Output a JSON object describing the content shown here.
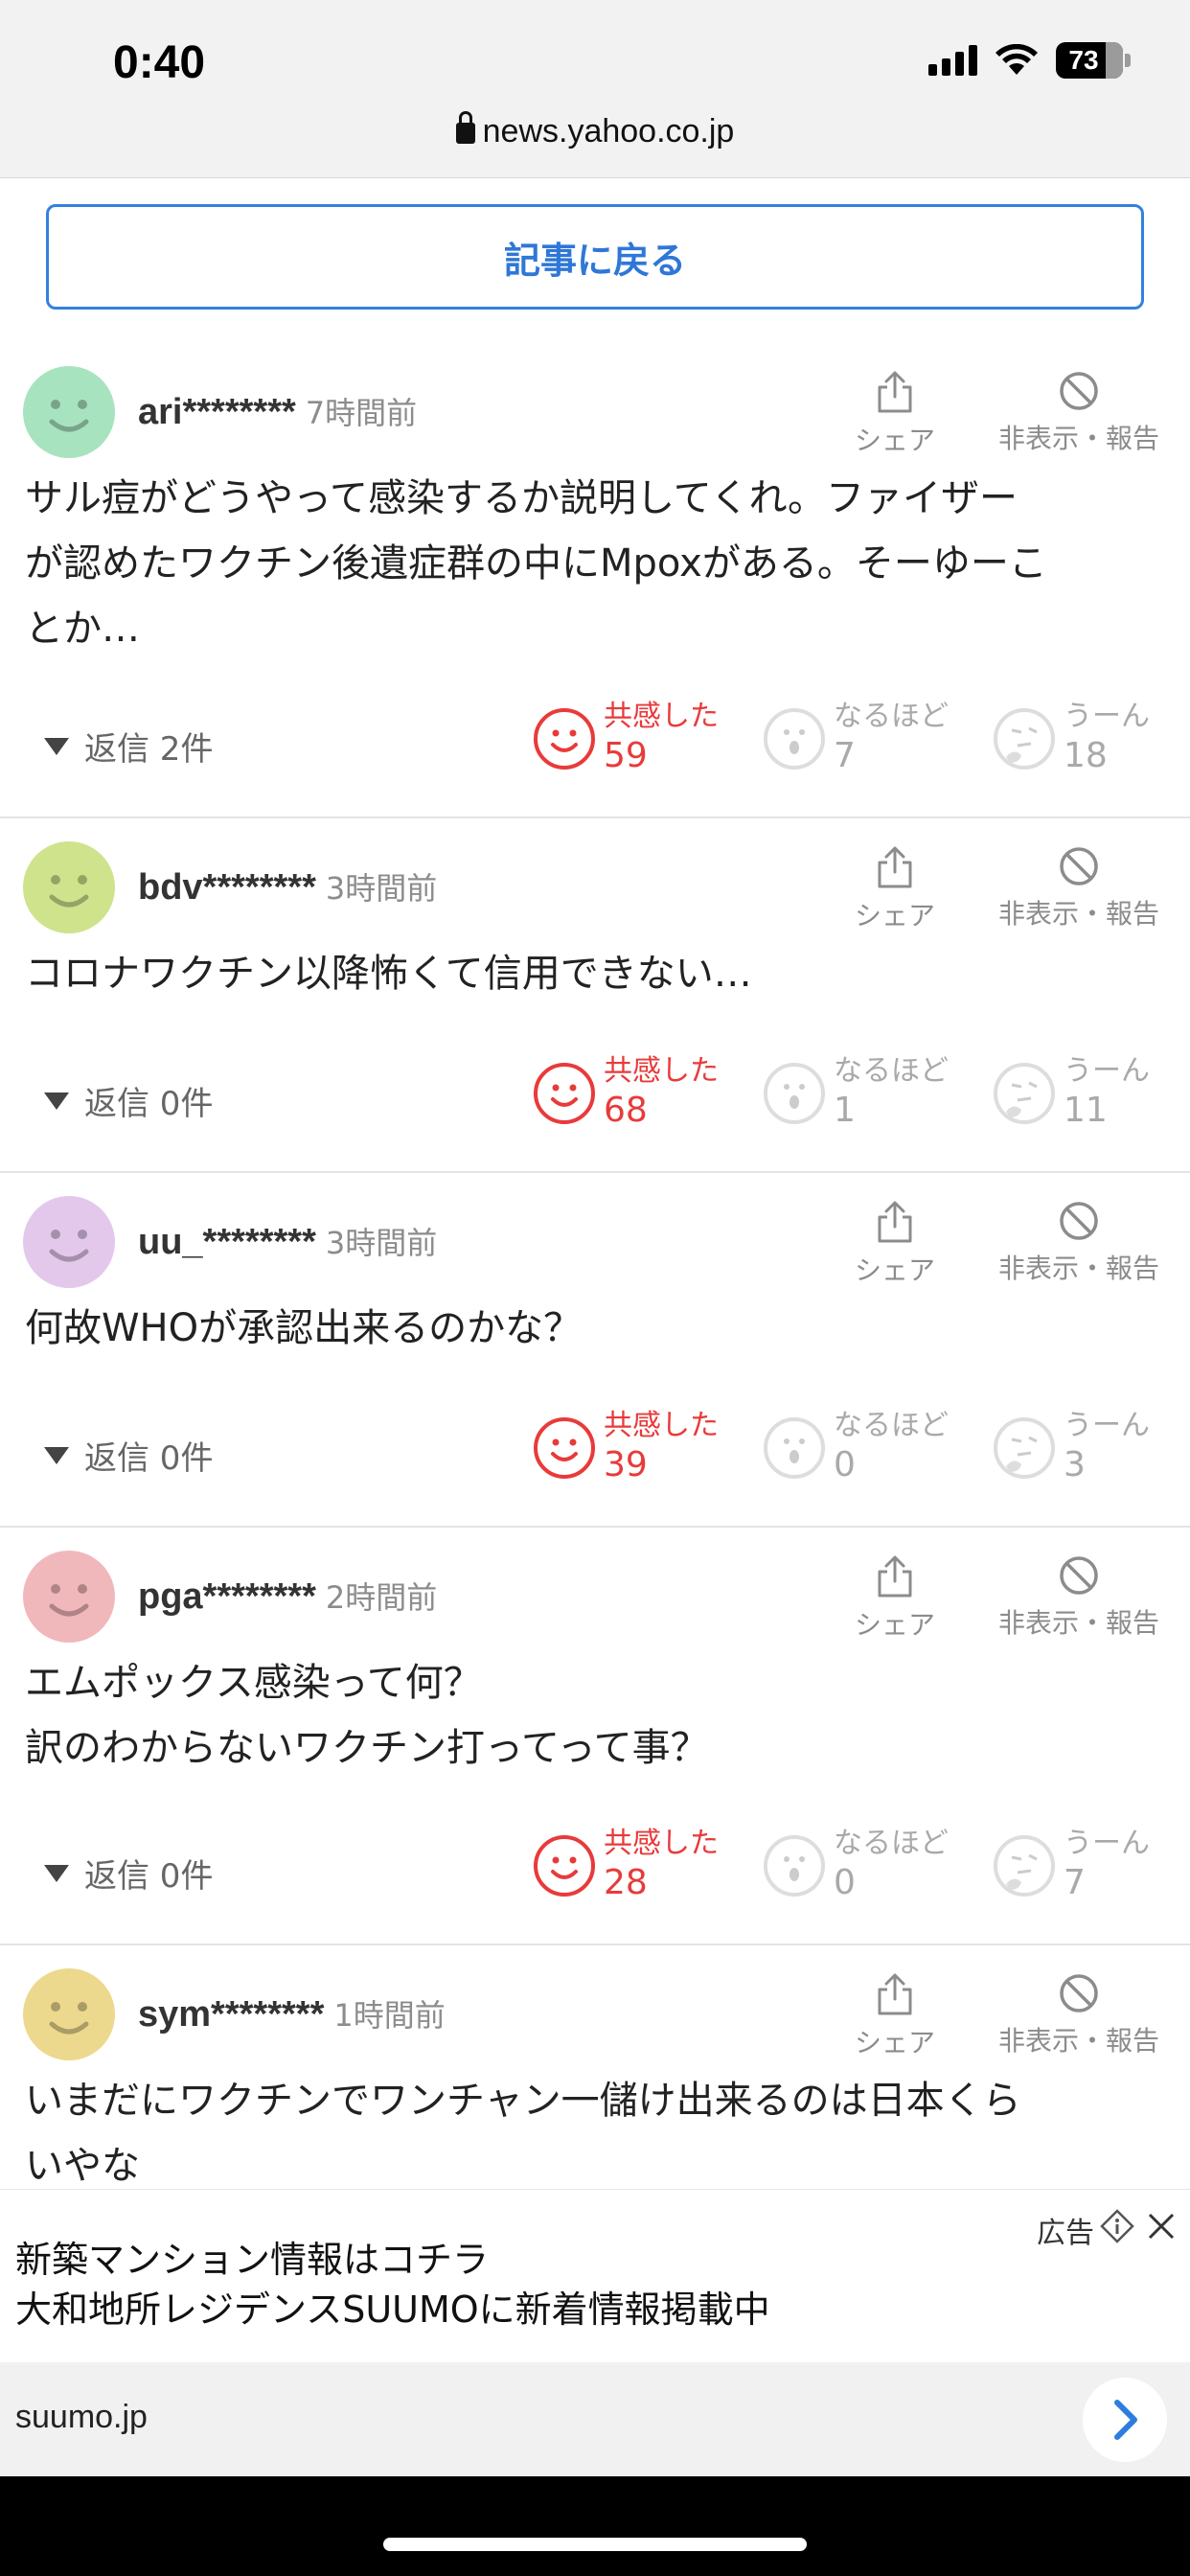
{
  "status_bar": {
    "time": "0:40",
    "battery": "73",
    "url": "news.yahoo.co.jp"
  },
  "back_button": "記事に戻る",
  "labels": {
    "share": "シェア",
    "hide_report": "非表示・報告",
    "empathy": "共感した",
    "naruhodo": "なるほど",
    "uun": "うーん"
  },
  "comments": [
    {
      "user": "ari********",
      "ago": "7時間前",
      "avatar_color": "#a8e3c0",
      "lines": [
        "サル痘がどうやって感染するか説明してくれ。ファイザー",
        "が認めたワクチン後遺症群の中にMpoxがある。そーゆーこ",
        "とか…"
      ],
      "replies": "返信 2件",
      "empathy": "59",
      "naruhodo": "7",
      "uun": "18"
    },
    {
      "user": "bdv********",
      "ago": "3時間前",
      "avatar_color": "#cfe38c",
      "lines": [
        "コロナワクチン以降怖くて信用できない…"
      ],
      "replies": "返信 0件",
      "empathy": "68",
      "naruhodo": "1",
      "uun": "11"
    },
    {
      "user": "uu_********",
      "ago": "3時間前",
      "avatar_color": "#e3c8ec",
      "lines": [
        "何故WHOが承認出来るのかな？"
      ],
      "replies": "返信 0件",
      "empathy": "39",
      "naruhodo": "0",
      "uun": "3"
    },
    {
      "user": "pga********",
      "ago": "2時間前",
      "avatar_color": "#f1b8bc",
      "lines": [
        "エムポックス感染って何？",
        "訳のわからないワクチン打ってって事？"
      ],
      "replies": "返信 0件",
      "empathy": "28",
      "naruhodo": "0",
      "uun": "7"
    },
    {
      "user": "sym********",
      "ago": "1時間前",
      "avatar_color": "#ecd98e",
      "lines": [
        "いまだにワクチンでワンチャン一儲け出来るのは日本くら",
        "いやな"
      ]
    }
  ],
  "ad": {
    "label": "広告",
    "title1": "新築マンション情報はコチラ",
    "title2": "大和地所レジデンスSUUMOに新着情報掲載中",
    "domain": "suumo.jp"
  }
}
